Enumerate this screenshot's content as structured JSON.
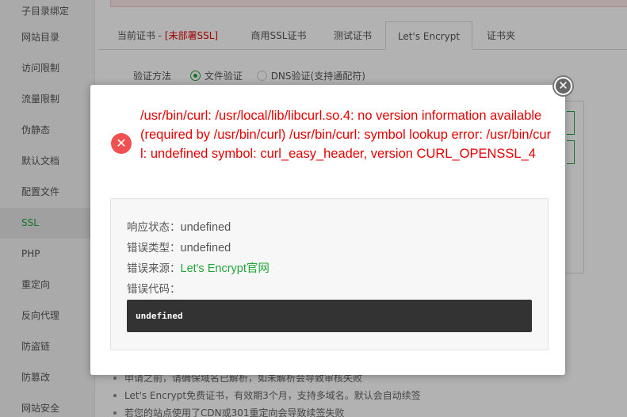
{
  "sidebar": {
    "items": [
      {
        "label": "子目录绑定"
      },
      {
        "label": "网站目录"
      },
      {
        "label": "访问限制"
      },
      {
        "label": "流量限制"
      },
      {
        "label": "伪静态"
      },
      {
        "label": "默认文档"
      },
      {
        "label": "配置文件"
      },
      {
        "label": "SSL"
      },
      {
        "label": "PHP"
      },
      {
        "label": "重定向"
      },
      {
        "label": "反向代理"
      },
      {
        "label": "防盗链"
      },
      {
        "label": "防篡改"
      },
      {
        "label": "网站安全"
      }
    ],
    "active_index": 7,
    "active_color": "#20a53a"
  },
  "tabs": {
    "current_cert_prefix": "当前证书 - ",
    "current_cert_status": "[未部署SSL]",
    "commercial": "商用SSL证书",
    "test": "测试证书",
    "letsencrypt": "Let's Encrypt",
    "cert_folder": "证书夹"
  },
  "verify": {
    "label": "验证方法",
    "file_option": "文件验证",
    "dns_option": "DNS验证(支持通配符)",
    "selected": "文件验证"
  },
  "tips": [
    "申请之前，请确保域名已解析，如未解析会导致审核失败",
    "Let's Encrypt免费证书，有效期3个月，支持多域名。默认会自动续签",
    "若您的站点使用了CDN或301重定向会导致续签失败"
  ],
  "modal": {
    "error_message": "/usr/bin/curl: /usr/local/lib/libcurl.so.4: no version information available (required by /usr/bin/curl) /usr/bin/curl: symbol lookup error: /usr/bin/curl: undefined symbol: curl_easy_header, version CURL_OPENSSL_4",
    "status_label": "响应状态：",
    "status_value": "undefined",
    "type_label": "错误类型：",
    "type_value": "undefined",
    "source_label": "错误来源：",
    "source_value": "Let's Encrypt官网",
    "code_label": "错误代码：",
    "code_value": "undefined",
    "error_color": "#e60000",
    "link_color": "#20a53a"
  },
  "icons": {
    "close": "close-icon",
    "error": "error-icon"
  }
}
